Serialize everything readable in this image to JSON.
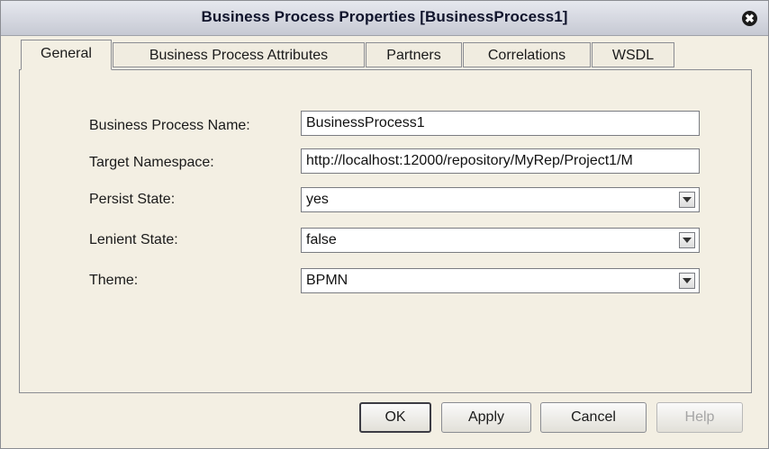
{
  "window": {
    "title": "Business Process Properties [BusinessProcess1]",
    "close_symbol": "✖"
  },
  "tabs": [
    {
      "label": "General",
      "selected": true
    },
    {
      "label": "Business Process Attributes",
      "selected": false
    },
    {
      "label": "Partners",
      "selected": false
    },
    {
      "label": "Correlations",
      "selected": false
    },
    {
      "label": "WSDL",
      "selected": false
    }
  ],
  "form": {
    "name": {
      "label": "Business Process Name:",
      "value": "BusinessProcess1"
    },
    "namespace": {
      "label": "Target Namespace:",
      "value": "http://localhost:12000/repository/MyRep/Project1/M"
    },
    "persist": {
      "label": "Persist State:",
      "value": "yes"
    },
    "lenient": {
      "label": "Lenient State:",
      "value": "false"
    },
    "theme": {
      "label": "Theme:",
      "value": "BPMN"
    }
  },
  "buttons": {
    "ok": "OK",
    "apply": "Apply",
    "cancel": "Cancel",
    "help": "Help"
  },
  "colors": {
    "dialog_background": "#f3efe3",
    "titlebar": "#c6c9d3",
    "disabled_text": "#a5a5a5"
  }
}
